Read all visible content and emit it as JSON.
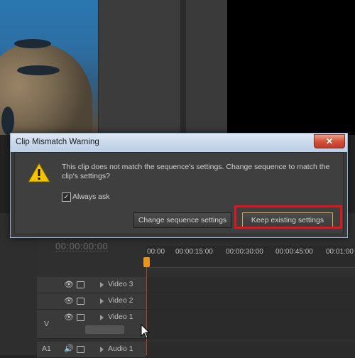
{
  "dialog": {
    "title": "Clip Mismatch Warning",
    "close_glyph": "✕",
    "message": "This clip does not match the sequence's settings. Change sequence to match the clip's settings?",
    "checkbox": {
      "label": "Always ask",
      "checked": true,
      "check_glyph": "✓"
    },
    "buttons": {
      "change": "Change sequence settings",
      "keep": "Keep existing settings"
    }
  },
  "timeline": {
    "timecode": "00:00:00:00",
    "ruler": [
      "00:00",
      "00:00:15:00",
      "00:00:30:00",
      "00:00:45:00",
      "00:01:00"
    ],
    "tracks": [
      {
        "name": "Video 3",
        "tag": ""
      },
      {
        "name": "Video 2",
        "tag": ""
      },
      {
        "name": "Video 1",
        "tag": "V"
      },
      {
        "name": "Audio 1",
        "tag": "A1"
      }
    ]
  },
  "colors": {
    "highlight": "#e0161e",
    "playhead": "#c7361f",
    "playhead_head": "#e7951c",
    "accent_button_border": "#d9a640"
  },
  "icons": [
    "warning-icon",
    "close-icon",
    "eye-icon",
    "film-icon",
    "expand-triangle-icon",
    "checkmark-icon",
    "speaker-icon",
    "mouse-cursor-icon"
  ]
}
